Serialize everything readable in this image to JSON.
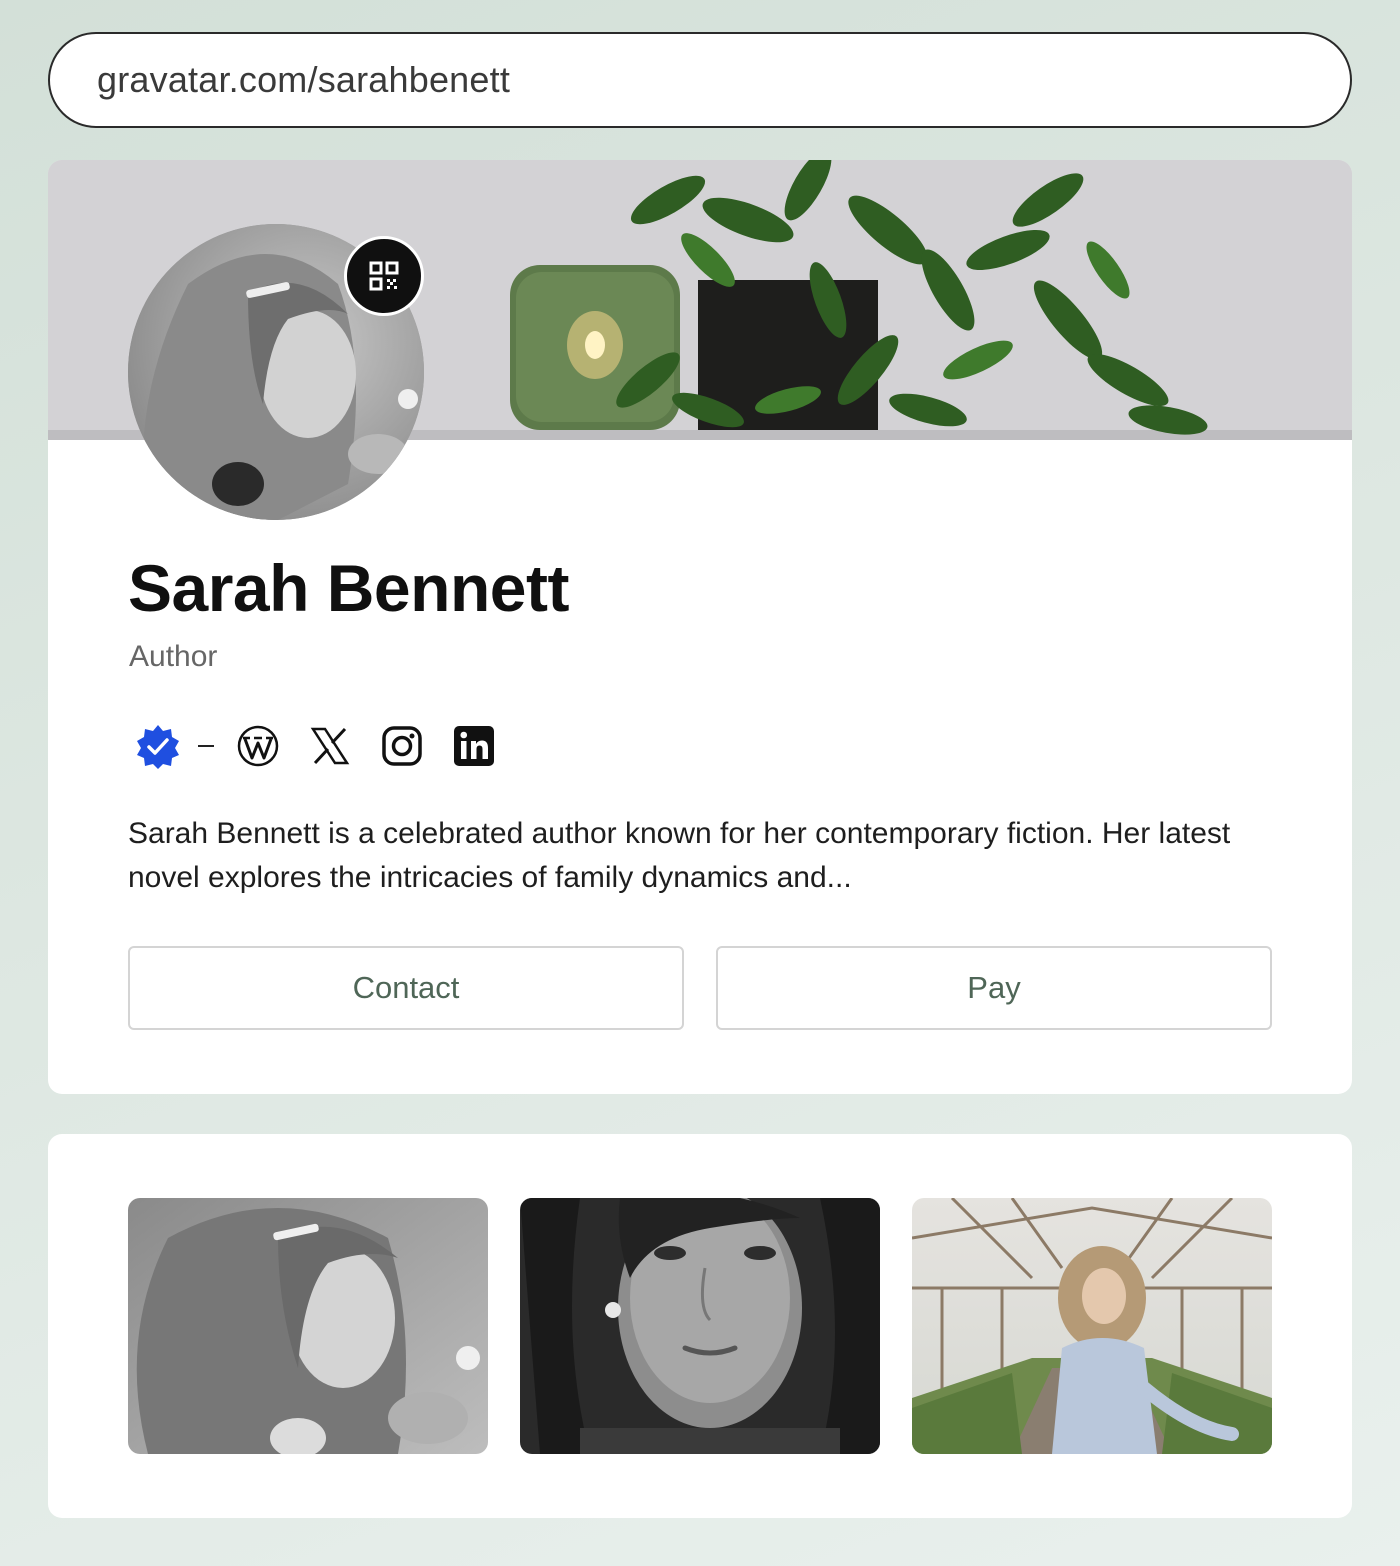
{
  "url_bar": {
    "text": "gravatar.com/sarahbenett"
  },
  "profile": {
    "name": "Sarah Bennett",
    "role": "Author",
    "bio": "Sarah Bennett is a celebrated author known for her contemporary fiction. Her latest novel explores the intricacies of family dynamics and...",
    "verified_color": "#1f4fe0"
  },
  "socials": [
    {
      "icon": "verified-badge-icon"
    },
    {
      "icon": "wordpress-icon"
    },
    {
      "icon": "x-icon"
    },
    {
      "icon": "instagram-icon"
    },
    {
      "icon": "linkedin-icon"
    }
  ],
  "actions": {
    "contact_label": "Contact",
    "pay_label": "Pay"
  },
  "colors": {
    "accent_text": "#4f6657",
    "background": "#d3e0d8"
  }
}
